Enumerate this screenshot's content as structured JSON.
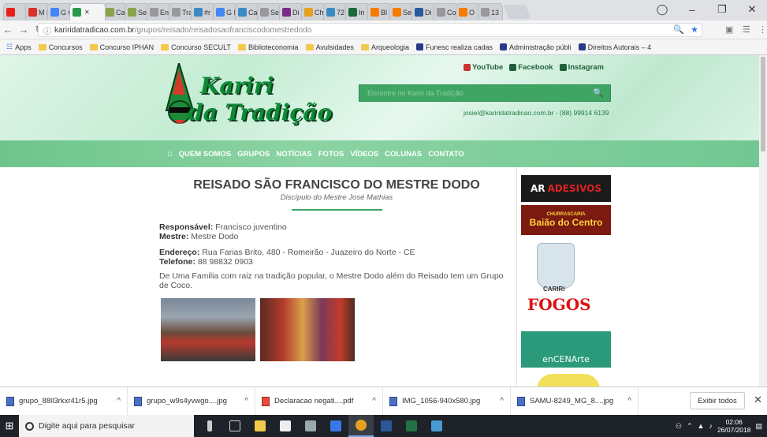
{
  "browser": {
    "tabs": [
      {
        "label": "",
        "color": "#e62117"
      },
      {
        "label": "M Em",
        "color": "#d93025"
      },
      {
        "label": "G Go",
        "color": "#4285f4"
      },
      {
        "label": "",
        "color": "#2a9a4a",
        "active": true
      },
      {
        "label": "Ca",
        "color": "#8aa24a"
      },
      {
        "label": "Se",
        "color": "#8aa24a"
      },
      {
        "label": "En",
        "color": "#999999"
      },
      {
        "label": "Tra",
        "color": "#999999"
      },
      {
        "label": "#r",
        "color": "#3a8ac4"
      },
      {
        "label": "G M",
        "color": "#4285f4"
      },
      {
        "label": "Ca",
        "color": "#3a8ac4"
      },
      {
        "label": "Se",
        "color": "#999999"
      },
      {
        "label": "Di",
        "color": "#7a2a8a"
      },
      {
        "label": "Ch",
        "color": "#e8a020"
      },
      {
        "label": "72",
        "color": "#3a8ac4"
      },
      {
        "label": "In",
        "color": "#1a6a3a"
      },
      {
        "label": "Bl",
        "color": "#f57c00"
      },
      {
        "label": "Se",
        "color": "#f57c00"
      },
      {
        "label": "Di",
        "color": "#2a5a9a"
      },
      {
        "label": "Co",
        "color": "#999999"
      },
      {
        "label": "O",
        "color": "#f57c00"
      },
      {
        "label": "13",
        "color": "#999999"
      }
    ],
    "url_domain": "kariridatradicao.com.br",
    "url_path": "/grupos/reisado/reisadosaofranciscodomestredodo",
    "bookmarks": [
      {
        "label": "Apps",
        "kind": "apps"
      },
      {
        "label": "Concursos",
        "kind": "folder"
      },
      {
        "label": "Concurso IPHAN",
        "kind": "folder"
      },
      {
        "label": "Concurso SECULT",
        "kind": "folder"
      },
      {
        "label": "Biblioteconomia",
        "kind": "folder"
      },
      {
        "label": "Avulsidades",
        "kind": "folder"
      },
      {
        "label": "Arqueologia",
        "kind": "folder"
      },
      {
        "label": "Funesc realiza cadas",
        "kind": "site"
      },
      {
        "label": "Administração públi",
        "kind": "site"
      },
      {
        "label": "Direitos Autorais – 4",
        "kind": "site"
      }
    ]
  },
  "site": {
    "logo_line1": "Kariri",
    "logo_line2": "da Tradição",
    "social": [
      "YouTube",
      "Facebook",
      "Instagram"
    ],
    "search_placeholder": "Encontre no Kariri da Tradição",
    "contact": "josiel@kariridatradicao.com.br - (88) 99914 6139",
    "nav": [
      "QUEM SOMOS",
      "GRUPOS",
      "NOTÍCIAS",
      "FOTOS",
      "VÍDEOS",
      "COLUNAS",
      "CONTATO"
    ]
  },
  "article": {
    "title": "REISADO SÃO FRANCISCO DO MESTRE DODO",
    "subtitle": "Discípulo do Mestre José Mathias",
    "responsavel_label": "Responsável:",
    "responsavel": "Francisco juventino",
    "mestre_label": "Mestre:",
    "mestre": "Mestre Dodo",
    "endereco_label": "Endereço:",
    "endereco": "Rua Farias Brito, 480 - Romeirão - Juazeiro do Norte - CE",
    "telefone_label": "Telefone:",
    "telefone": "88 98832 0903",
    "descricao": "De Uma Familia com raiz na tradição popular, o Mestre Dodo além do Reisado tem um Grupo de Coco."
  },
  "ads": {
    "ad1": "ADESIVOS",
    "ad2_top": "CHURRASCARIA",
    "ad2": "Baião do Centro",
    "ad3_top": "CARIRI",
    "ad3": "FOGOS",
    "ad4": "enCENArte"
  },
  "downloads": [
    {
      "name": "grupo_88ll3rkxr41r5.jpg",
      "type": "img"
    },
    {
      "name": "grupo_w9s4yvwgo....jpg",
      "type": "img"
    },
    {
      "name": "Declaracao negati....pdf",
      "type": "pdf"
    },
    {
      "name": "IMG_1056-940x580.jpg",
      "type": "img"
    },
    {
      "name": "SAMU-8249_MG_8....jpg",
      "type": "img"
    }
  ],
  "downloads_show_all": "Exibir todos",
  "taskbar": {
    "search_placeholder": "Digite aqui para pesquisar",
    "time": "02:06",
    "date": "26/07/2018"
  }
}
